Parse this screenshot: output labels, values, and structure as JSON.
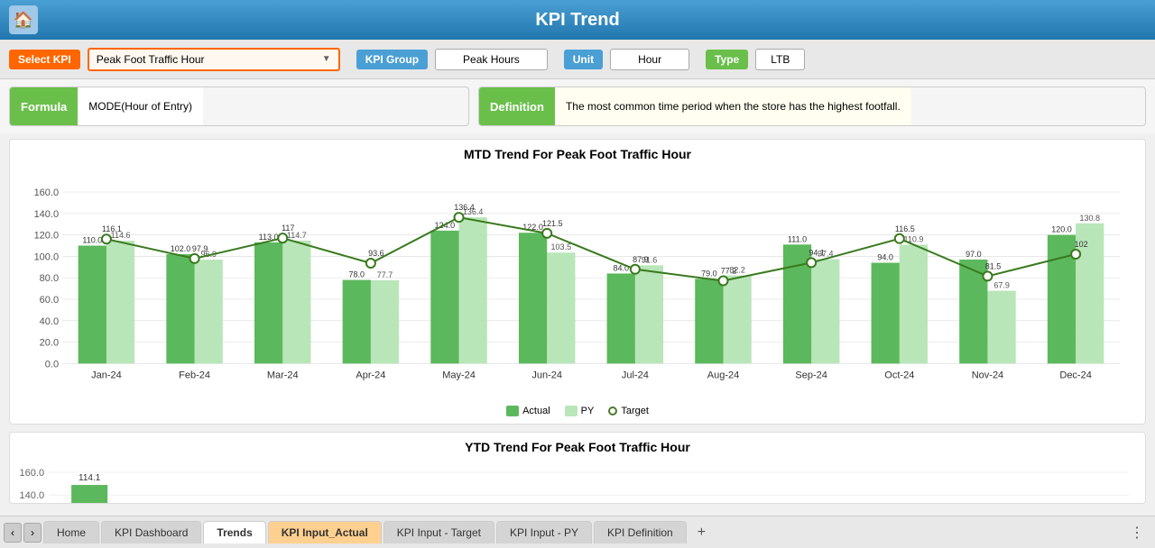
{
  "header": {
    "title": "KPI Trend",
    "home_icon": "🏠"
  },
  "kpi_bar": {
    "select_kpi_label": "Select KPI",
    "select_kpi_value": "Peak Foot Traffic Hour",
    "kpi_group_label": "KPI Group",
    "kpi_group_value": "Peak Hours",
    "unit_label": "Unit",
    "unit_value": "Hour",
    "type_label": "Type",
    "type_value": "LTB"
  },
  "formula_bar": {
    "formula_label": "Formula",
    "formula_value": "MODE(Hour of Entry)",
    "definition_label": "Definition",
    "definition_value": "The most common time period when the store has the highest footfall."
  },
  "mtd_chart": {
    "title": "MTD Trend For Peak Foot Traffic Hour",
    "y_max": 160,
    "y_step": 20,
    "months": [
      "Jan-24",
      "Feb-24",
      "Mar-24",
      "Apr-24",
      "May-24",
      "Jun-24",
      "Jul-24",
      "Aug-24",
      "Sep-24",
      "Oct-24",
      "Nov-24",
      "Dec-24"
    ],
    "actual": [
      110.0,
      102.0,
      113.0,
      78.0,
      124.0,
      122.0,
      84.0,
      79.0,
      111.0,
      94.0,
      97.0,
      120.0
    ],
    "py": [
      114.6,
      96.9,
      114.7,
      77.7,
      136.4,
      103.5,
      91.6,
      82.2,
      97.4,
      110.9,
      67.9,
      130.8
    ],
    "target": [
      116.1,
      97.9,
      117.0,
      93.6,
      136.4,
      121.5,
      87.9,
      77.2,
      94.1,
      116.5,
      81.5,
      102.0
    ]
  },
  "ytd_chart": {
    "title": "YTD Trend For Peak Foot Traffic Hour",
    "y_max": 160,
    "y_step": 20
  },
  "legend": {
    "actual_label": "Actual",
    "py_label": "PY",
    "target_label": "Target"
  },
  "tabs": [
    {
      "label": "Home",
      "active": false,
      "style": "default"
    },
    {
      "label": "KPI Dashboard",
      "active": false,
      "style": "default"
    },
    {
      "label": "Trends",
      "active": true,
      "style": "white"
    },
    {
      "label": "KPI Input_Actual",
      "active": false,
      "style": "orange"
    },
    {
      "label": "KPI Input - Target",
      "active": false,
      "style": "default"
    },
    {
      "label": "KPI Input - PY",
      "active": false,
      "style": "default"
    },
    {
      "label": "KPI Definition",
      "active": false,
      "style": "default"
    }
  ]
}
